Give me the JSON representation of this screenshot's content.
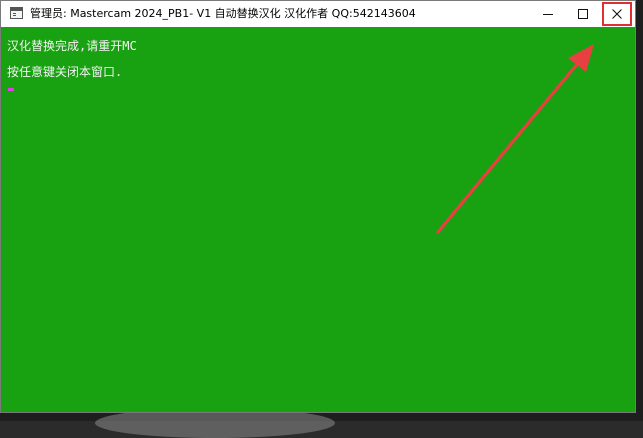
{
  "window": {
    "title": "管理员:  Mastercam 2024_PB1- V1 自动替换汉化  汉化作者 QQ:542143604",
    "controls": {
      "minimize_icon": "minimize-icon",
      "maximize_icon": "maximize-icon",
      "close_icon": "close-icon"
    }
  },
  "console": {
    "lines": [
      "汉化替换完成,请重开MC",
      "按任意键关闭本窗口."
    ],
    "background_color": "#18a110",
    "text_color": "#f4f4f4",
    "cursor_color": "#e040e0"
  },
  "annotation": {
    "arrow_color": "#e84040",
    "highlight_color": "#e02f2f",
    "points_to": "close-button"
  }
}
